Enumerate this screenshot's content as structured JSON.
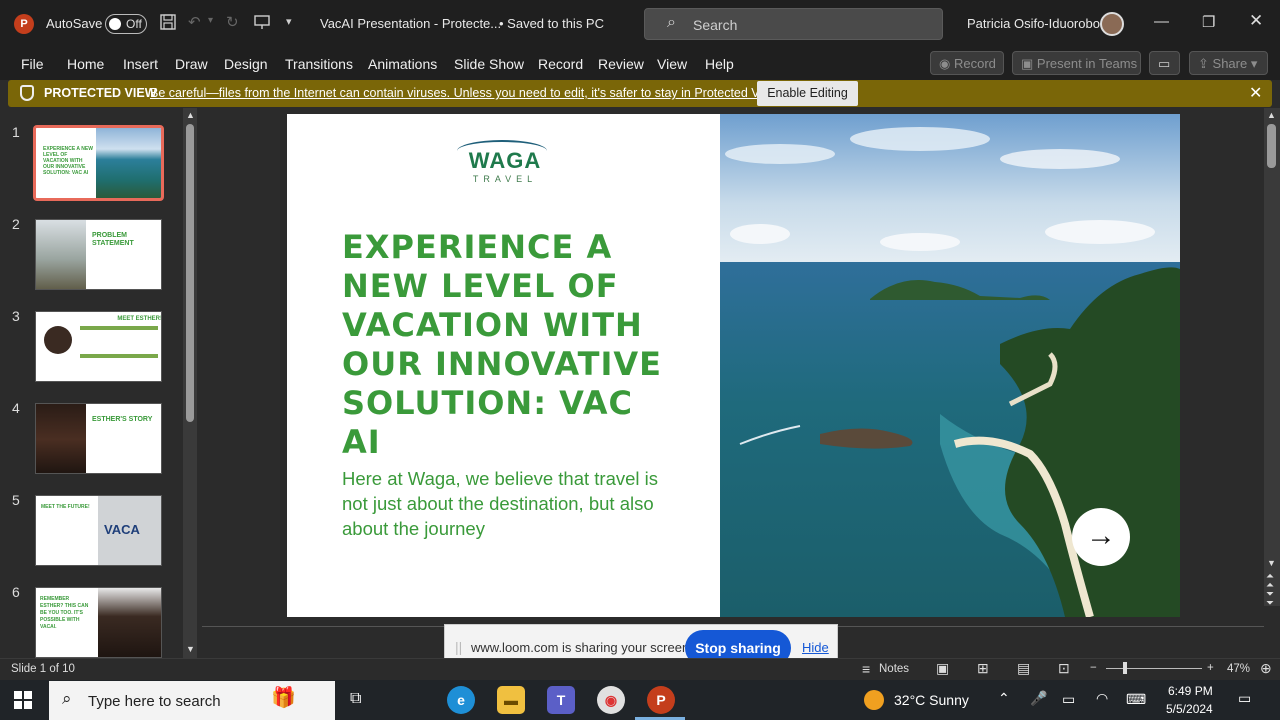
{
  "titlebar": {
    "app_letter": "P",
    "autosave_label": "AutoSave",
    "autosave_state": "Off",
    "doc_title": "VacAI Presentation  -  Protecte...",
    "save_status": "•  Saved to this PC",
    "search_placeholder": "Search",
    "user_name": "Patricia Osifo-Iduorobo"
  },
  "menu": {
    "items": [
      "File",
      "Home",
      "Insert",
      "Draw",
      "Design",
      "Transitions",
      "Animations",
      "Slide Show",
      "Record",
      "Review",
      "View",
      "Help"
    ],
    "record_btn": "Record",
    "teams_btn": "Present in Teams",
    "share_btn": "Share"
  },
  "protected_view": {
    "title": "PROTECTED VIEW",
    "message": "Be careful—files from the Internet can contain viruses. Unless you need to edit, it's safer to stay in Protected View.",
    "enable_button": "Enable Editing"
  },
  "thumbnails": [
    {
      "num": "1",
      "title": "EXPERIENCE A NEW LEVEL OF VACATION WITH OUR INNOVATIVE SOLUTION: VAC AI"
    },
    {
      "num": "2",
      "title": "PROBLEM STATEMENT"
    },
    {
      "num": "3",
      "title": "MEET ESTHER!"
    },
    {
      "num": "4",
      "title": "ESTHER'S STORY"
    },
    {
      "num": "5",
      "title": "MEET THE FUTURE!"
    },
    {
      "num": "6",
      "title": "REMEMBER ESTHER? THIS CAN BE YOU TOO. IT'S POSSIBLE WITH VACAI."
    }
  ],
  "slide": {
    "logo_name": "WAGA",
    "logo_sub": "TRAVEL",
    "headline": "EXPERIENCE A NEW LEVEL OF VACATION WITH OUR INNOVATIVE SOLUTION: VAC AI",
    "subtext": "Here at Waga, we believe that travel is not just about the destination, but also about the journey",
    "arrow": "→"
  },
  "loom": {
    "message": "www.loom.com is sharing your screen.",
    "stop_button": "Stop sharing",
    "hide_link": "Hide"
  },
  "status": {
    "slide_counter": "Slide 1 of 10",
    "notes_label": "Notes",
    "zoom": "47%"
  },
  "taskbar": {
    "search_placeholder": "Type here to search",
    "weather": "32°C  Sunny",
    "time": "6:49 PM",
    "date": "5/5/2024"
  },
  "colors": {
    "accent_green": "#3a9a3a",
    "protected_bar": "#7a6608",
    "loom_blue": "#1558d6",
    "powerpoint_red": "#c43e1c"
  }
}
